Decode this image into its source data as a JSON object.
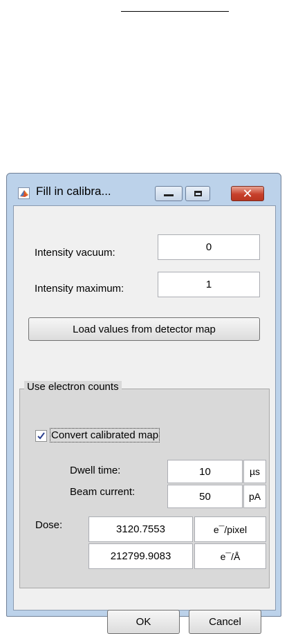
{
  "window": {
    "title": "Fill in calibra...",
    "icons": {
      "app": "matlab-icon",
      "minimize": "minimize-icon",
      "maximize": "maximize-icon",
      "close": "close-icon"
    },
    "close_glyph": "✕"
  },
  "intensity": {
    "vacuum_label": "Intensity vacuum:",
    "vacuum_value": "0",
    "maximum_label": "Intensity maximum:",
    "maximum_value": "1",
    "load_button": "Load values from detector map"
  },
  "electron_counts": {
    "group_title": "Use electron counts",
    "checkbox_label": "Convert calibrated map",
    "checkbox_checked": true,
    "dwell_label": "Dwell time:",
    "dwell_value": "10",
    "dwell_unit": "µs",
    "beam_label": "Beam current:",
    "beam_value": "50",
    "beam_unit": "pA",
    "dose_label": "Dose:",
    "dose_pixel_value": "3120.7553",
    "dose_pixel_unit": "e¯/pixel",
    "dose_area_value": "212799.9083",
    "dose_area_unit": "e¯/Å"
  },
  "buttons": {
    "ok": "OK",
    "cancel": "Cancel"
  },
  "colors": {
    "title_bar": "#bcd2ea",
    "close_button": "#c7402b",
    "client_bg": "#f0f0f0",
    "group_bg": "#d9d9d9"
  }
}
